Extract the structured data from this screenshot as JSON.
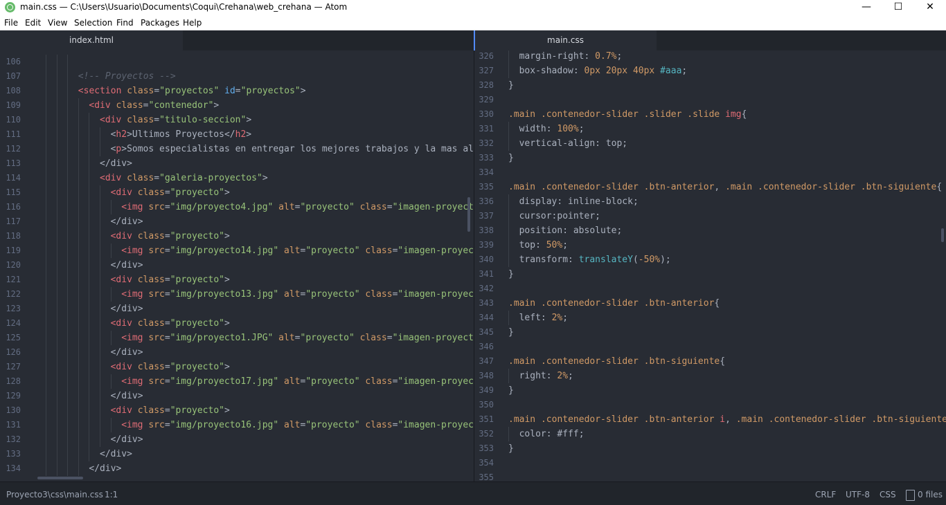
{
  "window": {
    "title": "main.css — C:\\Users\\Usuario\\Documents\\Coqui\\Crehana\\web_crehana — Atom",
    "controls": [
      "—",
      "☐",
      "✕"
    ]
  },
  "menu": [
    "File",
    "Edit",
    "View",
    "Selection",
    "Find",
    "Packages",
    "Help"
  ],
  "tabs": {
    "left": "index.html",
    "right": "main.css"
  },
  "left_pane": {
    "lines": [
      {
        "n": "106",
        "indent": 3,
        "tokens": []
      },
      {
        "n": "107",
        "indent": 3,
        "tokens": [
          {
            "t": "<!-- Proyectos -->",
            "c": "comment"
          }
        ]
      },
      {
        "n": "108",
        "indent": 3,
        "tokens": [
          {
            "t": "<section",
            "c": "tag"
          },
          {
            "t": " class",
            "c": "attr"
          },
          {
            "t": "=",
            "c": "prop"
          },
          {
            "t": "\"proyectos\"",
            "c": "str"
          },
          {
            "t": " id",
            "c": "id"
          },
          {
            "t": "=",
            "c": "prop"
          },
          {
            "t": "\"proyectos\"",
            "c": "str"
          },
          {
            "t": ">",
            "c": "prop"
          }
        ]
      },
      {
        "n": "109",
        "indent": 4,
        "tokens": [
          {
            "t": "<div",
            "c": "tag"
          },
          {
            "t": " class",
            "c": "attr"
          },
          {
            "t": "=",
            "c": "prop"
          },
          {
            "t": "\"contenedor\"",
            "c": "str"
          },
          {
            "t": ">",
            "c": "prop"
          }
        ]
      },
      {
        "n": "110",
        "indent": 5,
        "tokens": [
          {
            "t": "<div",
            "c": "tag"
          },
          {
            "t": " class",
            "c": "attr"
          },
          {
            "t": "=",
            "c": "prop"
          },
          {
            "t": "\"titulo-seccion\"",
            "c": "str"
          },
          {
            "t": ">",
            "c": "prop"
          }
        ]
      },
      {
        "n": "111",
        "indent": 6,
        "tokens": [
          {
            "t": "<",
            "c": "prop"
          },
          {
            "t": "h2",
            "c": "tag"
          },
          {
            "t": ">Ultimos Proyectos</",
            "c": "prop"
          },
          {
            "t": "h2",
            "c": "tag"
          },
          {
            "t": ">",
            "c": "prop"
          }
        ]
      },
      {
        "n": "112",
        "indent": 6,
        "tokens": [
          {
            "t": "<",
            "c": "prop"
          },
          {
            "t": "p",
            "c": "tag"
          },
          {
            "t": ">Somos especialistas en entregar los mejores trabajos y la mas alta",
            "c": "prop"
          }
        ]
      },
      {
        "n": "113",
        "indent": 5,
        "tokens": [
          {
            "t": "</div>",
            "c": "prop"
          }
        ]
      },
      {
        "n": "114",
        "indent": 5,
        "tokens": [
          {
            "t": "<div",
            "c": "tag"
          },
          {
            "t": " class",
            "c": "attr"
          },
          {
            "t": "=",
            "c": "prop"
          },
          {
            "t": "\"galeria-proyectos\"",
            "c": "str"
          },
          {
            "t": ">",
            "c": "prop"
          }
        ]
      },
      {
        "n": "115",
        "indent": 6,
        "tokens": [
          {
            "t": "<div",
            "c": "tag"
          },
          {
            "t": " class",
            "c": "attr"
          },
          {
            "t": "=",
            "c": "prop"
          },
          {
            "t": "\"proyecto\"",
            "c": "str"
          },
          {
            "t": ">",
            "c": "prop"
          }
        ]
      },
      {
        "n": "116",
        "indent": 7,
        "tokens": [
          {
            "t": "<img",
            "c": "tag"
          },
          {
            "t": " src",
            "c": "attr"
          },
          {
            "t": "=",
            "c": "prop"
          },
          {
            "t": "\"img/proyecto4.jpg\"",
            "c": "str"
          },
          {
            "t": " alt",
            "c": "attr"
          },
          {
            "t": "=",
            "c": "prop"
          },
          {
            "t": "\"proyecto\"",
            "c": "str"
          },
          {
            "t": " class",
            "c": "attr"
          },
          {
            "t": "=",
            "c": "prop"
          },
          {
            "t": "\"imagen-proyecto\"",
            "c": "str"
          }
        ]
      },
      {
        "n": "117",
        "indent": 6,
        "tokens": [
          {
            "t": "</div>",
            "c": "prop"
          }
        ]
      },
      {
        "n": "118",
        "indent": 6,
        "tokens": [
          {
            "t": "<div",
            "c": "tag"
          },
          {
            "t": " class",
            "c": "attr"
          },
          {
            "t": "=",
            "c": "prop"
          },
          {
            "t": "\"proyecto\"",
            "c": "str"
          },
          {
            "t": ">",
            "c": "prop"
          }
        ]
      },
      {
        "n": "119",
        "indent": 7,
        "tokens": [
          {
            "t": "<img",
            "c": "tag"
          },
          {
            "t": " src",
            "c": "attr"
          },
          {
            "t": "=",
            "c": "prop"
          },
          {
            "t": "\"img/proyecto14.jpg\"",
            "c": "str"
          },
          {
            "t": " alt",
            "c": "attr"
          },
          {
            "t": "=",
            "c": "prop"
          },
          {
            "t": "\"proyecto\"",
            "c": "str"
          },
          {
            "t": " class",
            "c": "attr"
          },
          {
            "t": "=",
            "c": "prop"
          },
          {
            "t": "\"imagen-proyecto",
            "c": "str"
          }
        ]
      },
      {
        "n": "120",
        "indent": 6,
        "tokens": [
          {
            "t": "</div>",
            "c": "prop"
          }
        ]
      },
      {
        "n": "121",
        "indent": 6,
        "tokens": [
          {
            "t": "<div",
            "c": "tag"
          },
          {
            "t": " class",
            "c": "attr"
          },
          {
            "t": "=",
            "c": "prop"
          },
          {
            "t": "\"proyecto\"",
            "c": "str"
          },
          {
            "t": ">",
            "c": "prop"
          }
        ]
      },
      {
        "n": "122",
        "indent": 7,
        "tokens": [
          {
            "t": "<img",
            "c": "tag"
          },
          {
            "t": " src",
            "c": "attr"
          },
          {
            "t": "=",
            "c": "prop"
          },
          {
            "t": "\"img/proyecto13.jpg\"",
            "c": "str"
          },
          {
            "t": " alt",
            "c": "attr"
          },
          {
            "t": "=",
            "c": "prop"
          },
          {
            "t": "\"proyecto\"",
            "c": "str"
          },
          {
            "t": " class",
            "c": "attr"
          },
          {
            "t": "=",
            "c": "prop"
          },
          {
            "t": "\"imagen-proyecto",
            "c": "str"
          }
        ]
      },
      {
        "n": "123",
        "indent": 6,
        "tokens": [
          {
            "t": "</div>",
            "c": "prop"
          }
        ]
      },
      {
        "n": "124",
        "indent": 6,
        "tokens": [
          {
            "t": "<div",
            "c": "tag"
          },
          {
            "t": " class",
            "c": "attr"
          },
          {
            "t": "=",
            "c": "prop"
          },
          {
            "t": "\"proyecto\"",
            "c": "str"
          },
          {
            "t": ">",
            "c": "prop"
          }
        ]
      },
      {
        "n": "125",
        "indent": 7,
        "tokens": [
          {
            "t": "<img",
            "c": "tag"
          },
          {
            "t": " src",
            "c": "attr"
          },
          {
            "t": "=",
            "c": "prop"
          },
          {
            "t": "\"img/proyecto1.JPG\"",
            "c": "str"
          },
          {
            "t": " alt",
            "c": "attr"
          },
          {
            "t": "=",
            "c": "prop"
          },
          {
            "t": "\"proyecto\"",
            "c": "str"
          },
          {
            "t": " class",
            "c": "attr"
          },
          {
            "t": "=",
            "c": "prop"
          },
          {
            "t": "\"imagen-proyecto\"",
            "c": "str"
          }
        ]
      },
      {
        "n": "126",
        "indent": 6,
        "tokens": [
          {
            "t": "</div>",
            "c": "prop"
          }
        ]
      },
      {
        "n": "127",
        "indent": 6,
        "tokens": [
          {
            "t": "<div",
            "c": "tag"
          },
          {
            "t": " class",
            "c": "attr"
          },
          {
            "t": "=",
            "c": "prop"
          },
          {
            "t": "\"proyecto\"",
            "c": "str"
          },
          {
            "t": ">",
            "c": "prop"
          }
        ]
      },
      {
        "n": "128",
        "indent": 7,
        "tokens": [
          {
            "t": "<img",
            "c": "tag"
          },
          {
            "t": " src",
            "c": "attr"
          },
          {
            "t": "=",
            "c": "prop"
          },
          {
            "t": "\"img/proyecto17.jpg\"",
            "c": "str"
          },
          {
            "t": " alt",
            "c": "attr"
          },
          {
            "t": "=",
            "c": "prop"
          },
          {
            "t": "\"proyecto\"",
            "c": "str"
          },
          {
            "t": " class",
            "c": "attr"
          },
          {
            "t": "=",
            "c": "prop"
          },
          {
            "t": "\"imagen-proyecto",
            "c": "str"
          }
        ]
      },
      {
        "n": "129",
        "indent": 6,
        "tokens": [
          {
            "t": "</div>",
            "c": "prop"
          }
        ]
      },
      {
        "n": "130",
        "indent": 6,
        "tokens": [
          {
            "t": "<div",
            "c": "tag"
          },
          {
            "t": " class",
            "c": "attr"
          },
          {
            "t": "=",
            "c": "prop"
          },
          {
            "t": "\"proyecto\"",
            "c": "str"
          },
          {
            "t": ">",
            "c": "prop"
          }
        ]
      },
      {
        "n": "131",
        "indent": 7,
        "tokens": [
          {
            "t": "<img",
            "c": "tag"
          },
          {
            "t": " src",
            "c": "attr"
          },
          {
            "t": "=",
            "c": "prop"
          },
          {
            "t": "\"img/proyecto16.jpg\"",
            "c": "str"
          },
          {
            "t": " alt",
            "c": "attr"
          },
          {
            "t": "=",
            "c": "prop"
          },
          {
            "t": "\"proyecto\"",
            "c": "str"
          },
          {
            "t": " class",
            "c": "attr"
          },
          {
            "t": "=",
            "c": "prop"
          },
          {
            "t": "\"imagen-proyecto",
            "c": "str"
          }
        ]
      },
      {
        "n": "132",
        "indent": 6,
        "tokens": [
          {
            "t": "</div>",
            "c": "prop"
          }
        ]
      },
      {
        "n": "133",
        "indent": 5,
        "tokens": [
          {
            "t": "</div>",
            "c": "prop"
          }
        ]
      },
      {
        "n": "134",
        "indent": 4,
        "tokens": [
          {
            "t": "</div>",
            "c": "prop"
          }
        ]
      }
    ]
  },
  "right_pane": {
    "lines": [
      {
        "n": "326",
        "indent": 1,
        "tokens": [
          {
            "t": "margin-right: ",
            "c": "prop"
          },
          {
            "t": "0.7%",
            "c": "num"
          },
          {
            "t": ";",
            "c": "prop"
          }
        ]
      },
      {
        "n": "327",
        "indent": 1,
        "tokens": [
          {
            "t": "box-shadow: ",
            "c": "prop"
          },
          {
            "t": "0px 20px 40px ",
            "c": "num"
          },
          {
            "t": "#aaa",
            "c": "hex"
          },
          {
            "t": ";",
            "c": "prop"
          }
        ]
      },
      {
        "n": "328",
        "indent": 0,
        "tokens": [
          {
            "t": "}",
            "c": "prop"
          }
        ]
      },
      {
        "n": "329",
        "indent": 0,
        "tokens": []
      },
      {
        "n": "330",
        "indent": 0,
        "tokens": [
          {
            "t": ".main .contenedor-slider .slider .slide ",
            "c": "cls"
          },
          {
            "t": "img",
            "c": "sel"
          },
          {
            "t": "{",
            "c": "prop"
          }
        ]
      },
      {
        "n": "331",
        "indent": 1,
        "tokens": [
          {
            "t": "width: ",
            "c": "prop"
          },
          {
            "t": "100%",
            "c": "num"
          },
          {
            "t": ";",
            "c": "prop"
          }
        ]
      },
      {
        "n": "332",
        "indent": 1,
        "tokens": [
          {
            "t": "vertical-align: top;",
            "c": "prop"
          }
        ]
      },
      {
        "n": "333",
        "indent": 0,
        "tokens": [
          {
            "t": "}",
            "c": "prop"
          }
        ]
      },
      {
        "n": "334",
        "indent": 0,
        "tokens": []
      },
      {
        "n": "335",
        "indent": 0,
        "tokens": [
          {
            "t": ".main .contenedor-slider .btn-anterior",
            "c": "cls"
          },
          {
            "t": ", ",
            "c": "prop"
          },
          {
            "t": ".main .contenedor-slider .btn-siguiente",
            "c": "cls"
          },
          {
            "t": "{",
            "c": "prop"
          }
        ]
      },
      {
        "n": "336",
        "indent": 1,
        "tokens": [
          {
            "t": "display: inline-block;",
            "c": "prop"
          }
        ]
      },
      {
        "n": "337",
        "indent": 1,
        "tokens": [
          {
            "t": "cursor:pointer;",
            "c": "prop"
          }
        ]
      },
      {
        "n": "338",
        "indent": 1,
        "tokens": [
          {
            "t": "position: absolute;",
            "c": "prop"
          }
        ]
      },
      {
        "n": "339",
        "indent": 1,
        "tokens": [
          {
            "t": "top: ",
            "c": "prop"
          },
          {
            "t": "50%",
            "c": "num"
          },
          {
            "t": ";",
            "c": "prop"
          }
        ]
      },
      {
        "n": "340",
        "indent": 1,
        "tokens": [
          {
            "t": "transform: ",
            "c": "prop"
          },
          {
            "t": "translateY",
            "c": "fn"
          },
          {
            "t": "(",
            "c": "prop"
          },
          {
            "t": "-50%",
            "c": "num"
          },
          {
            "t": ");",
            "c": "prop"
          }
        ]
      },
      {
        "n": "341",
        "indent": 0,
        "tokens": [
          {
            "t": "}",
            "c": "prop"
          }
        ]
      },
      {
        "n": "342",
        "indent": 0,
        "tokens": []
      },
      {
        "n": "343",
        "indent": 0,
        "tokens": [
          {
            "t": ".main .contenedor-slider .btn-anterior",
            "c": "cls"
          },
          {
            "t": "{",
            "c": "prop"
          }
        ]
      },
      {
        "n": "344",
        "indent": 1,
        "tokens": [
          {
            "t": "left: ",
            "c": "prop"
          },
          {
            "t": "2%",
            "c": "num"
          },
          {
            "t": ";",
            "c": "prop"
          }
        ]
      },
      {
        "n": "345",
        "indent": 0,
        "tokens": [
          {
            "t": "}",
            "c": "prop"
          }
        ]
      },
      {
        "n": "346",
        "indent": 0,
        "tokens": []
      },
      {
        "n": "347",
        "indent": 0,
        "tokens": [
          {
            "t": ".main .contenedor-slider .btn-siguiente",
            "c": "cls"
          },
          {
            "t": "{",
            "c": "prop"
          }
        ]
      },
      {
        "n": "348",
        "indent": 1,
        "tokens": [
          {
            "t": "right: ",
            "c": "prop"
          },
          {
            "t": "2%",
            "c": "num"
          },
          {
            "t": ";",
            "c": "prop"
          }
        ]
      },
      {
        "n": "349",
        "indent": 0,
        "tokens": [
          {
            "t": "}",
            "c": "prop"
          }
        ]
      },
      {
        "n": "350",
        "indent": 0,
        "tokens": []
      },
      {
        "n": "351",
        "indent": 0,
        "tokens": [
          {
            "t": ".main .contenedor-slider .btn-anterior ",
            "c": "cls"
          },
          {
            "t": "i",
            "c": "sel"
          },
          {
            "t": ", ",
            "c": "prop"
          },
          {
            "t": ".main .contenedor-slider .btn-siguiente",
            "c": "cls"
          }
        ]
      },
      {
        "n": "352",
        "indent": 1,
        "tokens": [
          {
            "t": "color: ",
            "c": "prop"
          },
          {
            "t": "#fff",
            "c": "prop"
          },
          {
            "t": ";",
            "c": "prop"
          }
        ]
      },
      {
        "n": "353",
        "indent": 0,
        "tokens": [
          {
            "t": "}",
            "c": "prop"
          }
        ]
      },
      {
        "n": "354",
        "indent": 0,
        "tokens": []
      },
      {
        "n": "355",
        "indent": 0,
        "tokens": []
      }
    ]
  },
  "statusbar": {
    "path": "Proyecto3\\css\\main.css",
    "cursor": "1:1",
    "line_ending": "CRLF",
    "encoding": "UTF-8",
    "grammar": "CSS",
    "files": "0 files"
  }
}
